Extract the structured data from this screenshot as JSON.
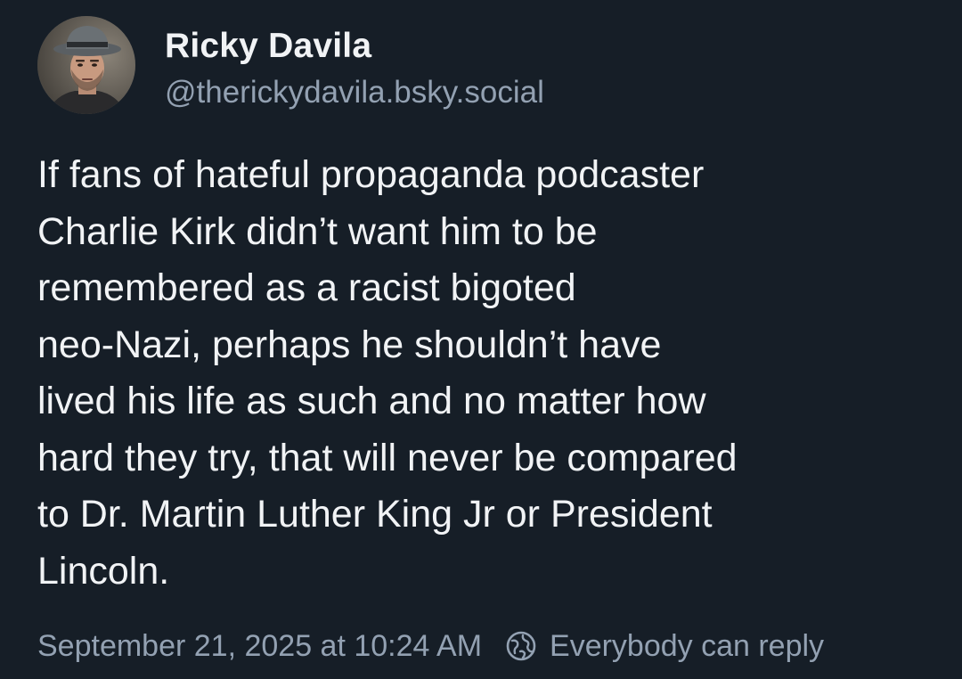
{
  "author": {
    "name": "Ricky Davila",
    "handle": "@therickydavila.bsky.social",
    "avatar_icon": "profile-photo"
  },
  "post": {
    "text": "If fans of hateful propaganda podcaster\nCharlie Kirk didn’t want him to be\nremembered as a racist bigoted\nneo-Nazi, perhaps he shouldn’t have\nlived his life as such and no matter how\nhard they try, that will never be compared\nto Dr. Martin Luther King Jr or President\nLincoln."
  },
  "meta": {
    "timestamp": "September 21, 2025 at 10:24 AM",
    "reply_icon": "globe-icon",
    "reply_setting": "Everybody can reply"
  },
  "colors": {
    "background": "#161e27",
    "text_primary": "#f1f3f5",
    "text_secondary": "#93a1b2"
  }
}
